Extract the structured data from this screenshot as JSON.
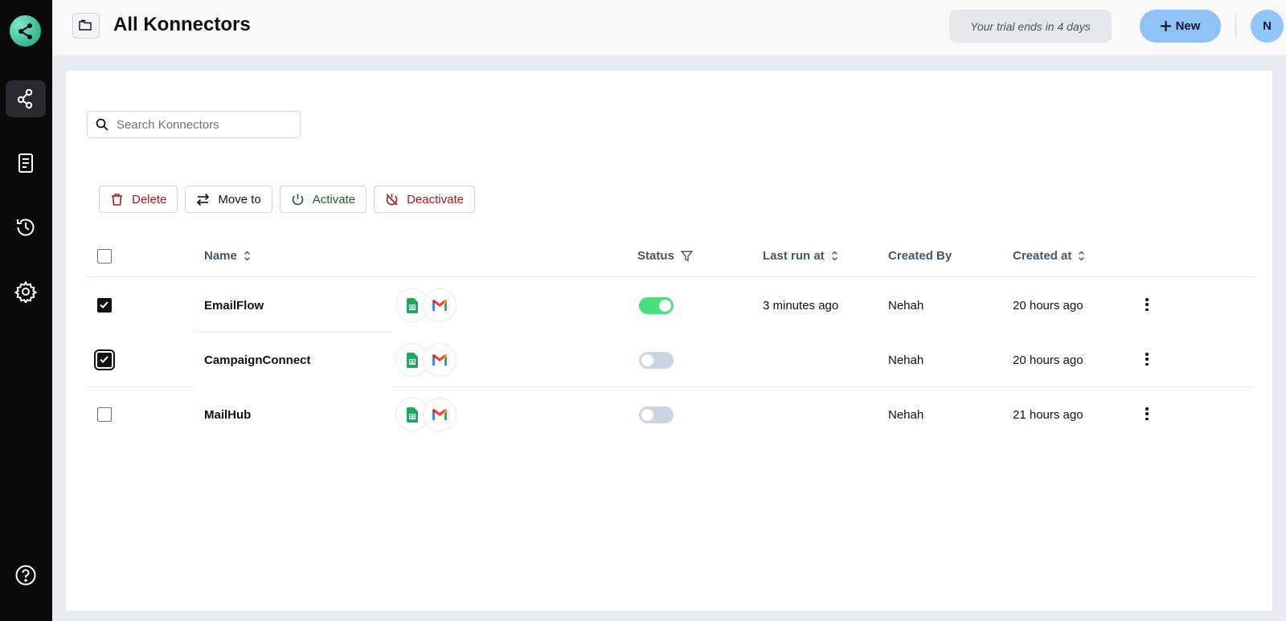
{
  "app": {
    "title": "All Konnectors"
  },
  "sidebar": {
    "items": [
      {
        "name": "konnectors",
        "icon": "share-nodes-icon",
        "active": true
      },
      {
        "name": "logs",
        "icon": "document-icon",
        "active": false
      },
      {
        "name": "history",
        "icon": "history-icon",
        "active": false
      },
      {
        "name": "settings",
        "icon": "gear-icon",
        "active": false
      }
    ],
    "help_icon": "help-icon"
  },
  "header": {
    "trial_text": "Your trial ends in 4 days",
    "new_label": "New",
    "avatar_initial": "N"
  },
  "search": {
    "placeholder": "Search Konnectors",
    "value": ""
  },
  "actions": {
    "delete_label": "Delete",
    "move_label": "Move to",
    "activate_label": "Activate",
    "deactivate_label": "Deactivate"
  },
  "table": {
    "columns": {
      "name": "Name",
      "status": "Status",
      "last_run": "Last run at",
      "created_by": "Created By",
      "created_at": "Created at"
    },
    "rows": [
      {
        "name": "EmailFlow",
        "apps": [
          "google-sheets-icon",
          "gmail-icon"
        ],
        "active": true,
        "last_run": "3 minutes ago",
        "created_by": "Nehah",
        "created_at": "20 hours ago",
        "checked": true
      },
      {
        "name": "CampaignConnect",
        "apps": [
          "google-sheets-icon",
          "gmail-icon"
        ],
        "active": false,
        "last_run": "",
        "created_by": "Nehah",
        "created_at": "20 hours ago",
        "checked": true
      },
      {
        "name": "MailHub",
        "apps": [
          "google-sheets-icon",
          "gmail-icon"
        ],
        "active": false,
        "last_run": "",
        "created_by": "Nehah",
        "created_at": "21 hours ago",
        "checked": false
      }
    ]
  },
  "colors": {
    "sidebar_bg": "#0a0a0b",
    "accent_blue": "#8fc2f7",
    "toggle_on": "#4ade80",
    "danger": "#a91b1b",
    "success": "#1d5e2b"
  }
}
